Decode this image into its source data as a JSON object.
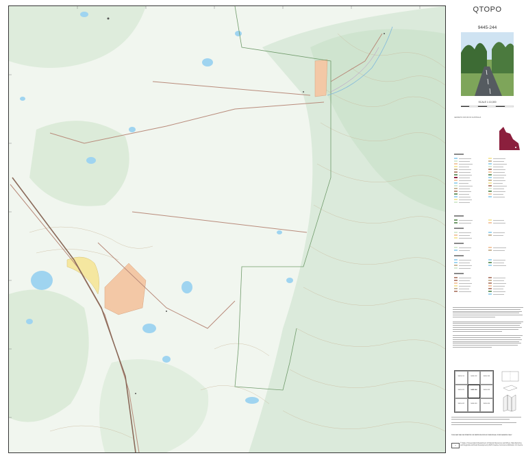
{
  "panel": {
    "title": "QTOPO",
    "sheet_number": "9445-244",
    "scale": "SCALE 1:10,000",
    "scale_ticks": [
      "200",
      "0",
      "200",
      "400",
      "600",
      "800"
    ],
    "projection_text": "GEODETIC DATUM OF AUSTRALIA",
    "qld_label": "",
    "index": {
      "cells": [
        [
          "9445-131",
          "9445-132",
          "9445-133"
        ],
        [
          "9445-241",
          "9445-244",
          "9445-243"
        ],
        [
          "9445-242",
          "9445-243",
          "9445-244"
        ]
      ]
    },
    "footer_line": "THIS MAP MAY BE PRINTED OR REPRODUCED BY INDIVIDUAL PURCHASERS ONLY",
    "copyright": "© State of Queensland (Department of Natural Resources and Mines, Manufacturing and Regional and Rural Development) 2025",
    "licence": "Creative Commons Attribution 4.0 licence"
  },
  "colors": {
    "vegetation": "#d6ead2",
    "cleared": "#f4f7f2",
    "water": "#9fd4f0",
    "contour": "#c9b79a",
    "road": "#b88a7a",
    "boundary": "#6f9a6a",
    "orange_area": "#f3c8a6",
    "yellow_area": "#f5e7a0",
    "queensland": "#8b1f3d"
  }
}
